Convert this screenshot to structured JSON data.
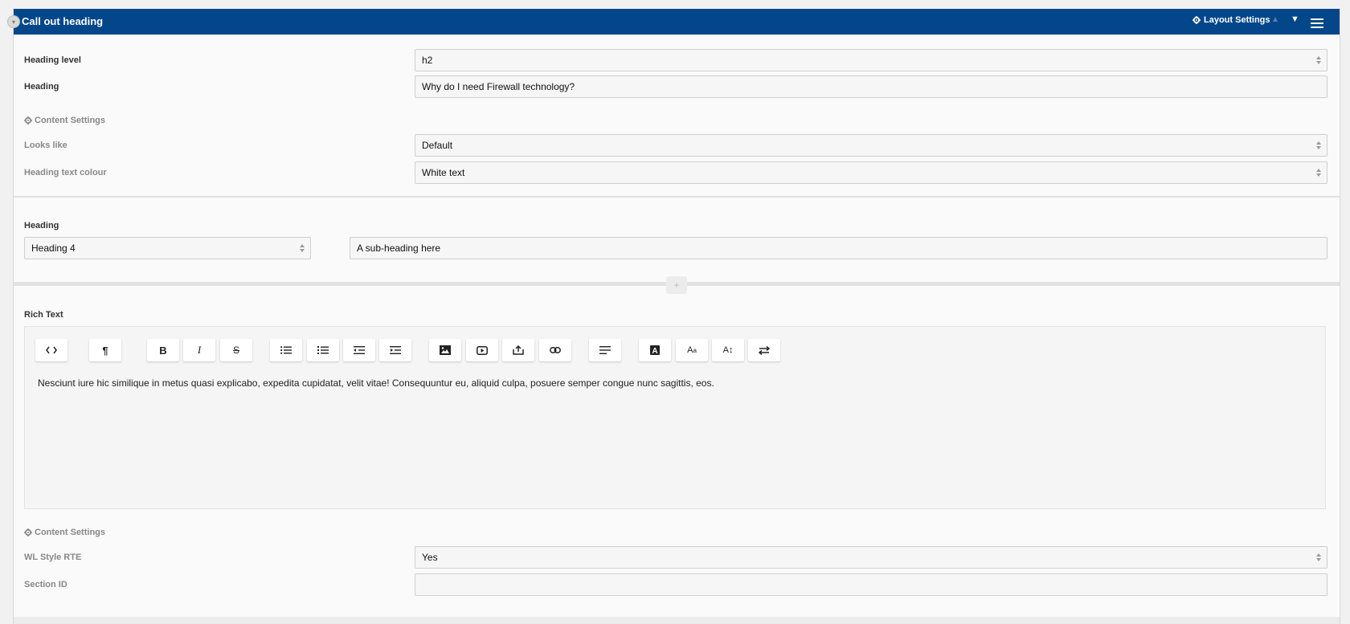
{
  "header": {
    "title": "Call out heading",
    "layout_settings_label": "Layout Settings",
    "icons": [
      "collapse-icon",
      "gear-icon",
      "arrow-up-icon",
      "arrow-down-icon",
      "hamburger-menu-icon"
    ],
    "bar_color": "#03478a"
  },
  "section1": {
    "heading_level_label": "Heading level",
    "heading_level_value": "h2",
    "heading_label": "Heading",
    "heading_value": "Why do I need Firewall technology?",
    "content_settings_label": "Content Settings",
    "looks_like_label": "Looks like",
    "looks_like_value": "Default",
    "text_colour_label": "Heading text colour",
    "text_colour_value": "White text"
  },
  "section2": {
    "heading_label": "Heading",
    "heading_type_value": "Heading 4",
    "subheading_value": "A sub-heading here",
    "add_label": "+"
  },
  "section3": {
    "rich_text_label": "Rich Text",
    "toolbar": [
      "code",
      "paragraph",
      "bold",
      "italic",
      "strikethrough",
      "bullet-list",
      "numbered-list",
      "outdent",
      "indent",
      "image",
      "video",
      "embed",
      "link",
      "align",
      "text-color",
      "font-size",
      "line-height",
      "direction"
    ],
    "body_text": "Nesciunt iure hic similique in metus quasi explicabo, expedita cupidatat, velit vitae! Consequuntur eu, aliquid culpa, posuere semper congue nunc sagittis, eos.",
    "content_settings_label": "Content Settings",
    "wl_style_label": "WL Style RTE",
    "wl_style_value": "Yes",
    "section_id_label": "Section ID",
    "section_id_value": ""
  }
}
